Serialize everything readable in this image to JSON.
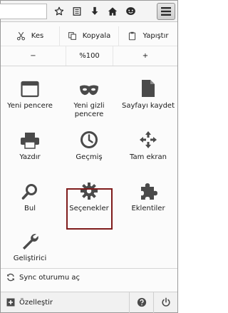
{
  "edit": {
    "cut": "Kes",
    "copy": "Kopyala",
    "paste": "Yapıştır"
  },
  "zoom": {
    "out": "−",
    "level": "%100",
    "in": "+"
  },
  "items": [
    {
      "name": "new-window",
      "label": "Yeni pencere"
    },
    {
      "name": "private-window",
      "label": "Yeni gizli pencere"
    },
    {
      "name": "save-page",
      "label": "Sayfayı kaydet"
    },
    {
      "name": "print",
      "label": "Yazdır"
    },
    {
      "name": "history",
      "label": "Geçmiş"
    },
    {
      "name": "fullscreen",
      "label": "Tam ekran"
    },
    {
      "name": "find",
      "label": "Bul"
    },
    {
      "name": "options",
      "label": "Seçenekler"
    },
    {
      "name": "addons",
      "label": "Eklentiler"
    },
    {
      "name": "developer",
      "label": "Geliştirici"
    }
  ],
  "sync": {
    "label": "Sync oturumu aç"
  },
  "footer": {
    "customize": "Özelleştir"
  },
  "colors": {
    "highlight": "#7f1c1c",
    "icon": "#4a4a4a"
  }
}
